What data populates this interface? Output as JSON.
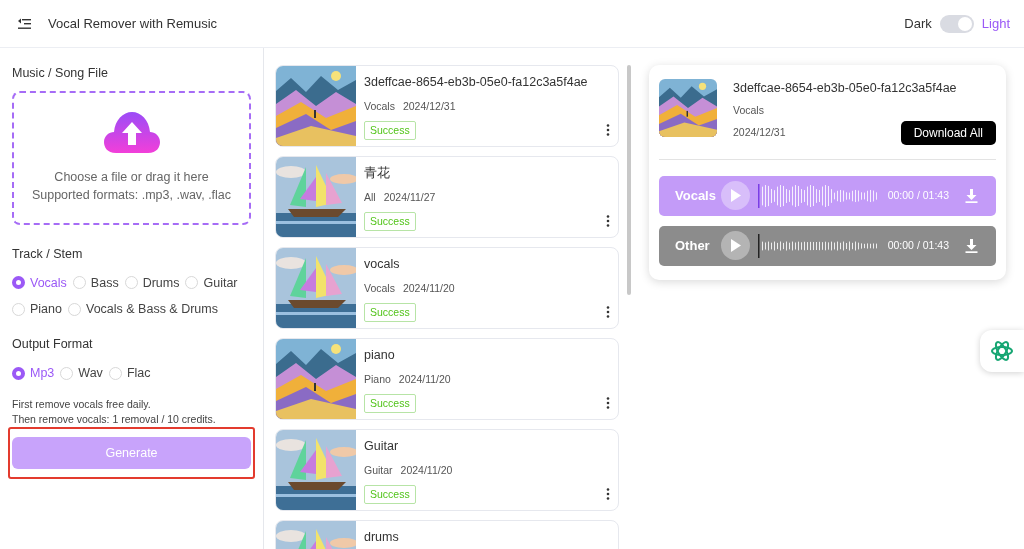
{
  "header": {
    "title": "Vocal Remover with Remusic",
    "theme": {
      "dark_label": "Dark",
      "light_label": "Light",
      "on": true
    }
  },
  "form": {
    "file_label": "Music / Song File",
    "dropzone": {
      "line1": "Choose a file or drag it here",
      "line2": "Supported formats: .mp3, .wav, .flac"
    },
    "stem_label": "Track / Stem",
    "stems": [
      {
        "label": "Vocals",
        "selected": true
      },
      {
        "label": "Bass",
        "selected": false
      },
      {
        "label": "Drums",
        "selected": false
      },
      {
        "label": "Guitar",
        "selected": false
      },
      {
        "label": "Piano",
        "selected": false
      },
      {
        "label": "Vocals & Bass & Drums",
        "selected": false
      }
    ],
    "format_label": "Output Format",
    "formats": [
      {
        "label": "Mp3",
        "selected": true
      },
      {
        "label": "Wav",
        "selected": false
      },
      {
        "label": "Flac",
        "selected": false
      }
    ],
    "note": [
      "First remove vocals free daily.",
      "Then remove vocals: 1 removal / 10 credits."
    ],
    "generate": {
      "label": "Generate",
      "highlighted": true
    }
  },
  "history": [
    {
      "title": "3deffcae-8654-eb3b-05e0-fa12c3a5f4ae",
      "stem": "Vocals",
      "date": "2024/12/31",
      "status": "Success"
    },
    {
      "title": "青花",
      "stem": "All",
      "date": "2024/11/27",
      "status": "Success"
    },
    {
      "title": "vocals",
      "stem": "Vocals",
      "date": "2024/11/20",
      "status": "Success"
    },
    {
      "title": "piano",
      "stem": "Piano",
      "date": "2024/11/20",
      "status": "Success"
    },
    {
      "title": "Guitar",
      "stem": "Guitar",
      "date": "2024/11/20",
      "status": "Success"
    },
    {
      "title": "drums"
    }
  ],
  "detail": {
    "title": "3deffcae-8654-eb3b-05e0-fa12c3a5f4ae",
    "stem": "Vocals",
    "date": "2024/12/31",
    "download_all": "Download All",
    "tracks": [
      {
        "name": "Vocals",
        "color": "#c39bf8",
        "time": "00:00 / 01:43"
      },
      {
        "name": "Other",
        "color": "#8c8c8c",
        "time": "00:00 / 01:43"
      }
    ]
  }
}
